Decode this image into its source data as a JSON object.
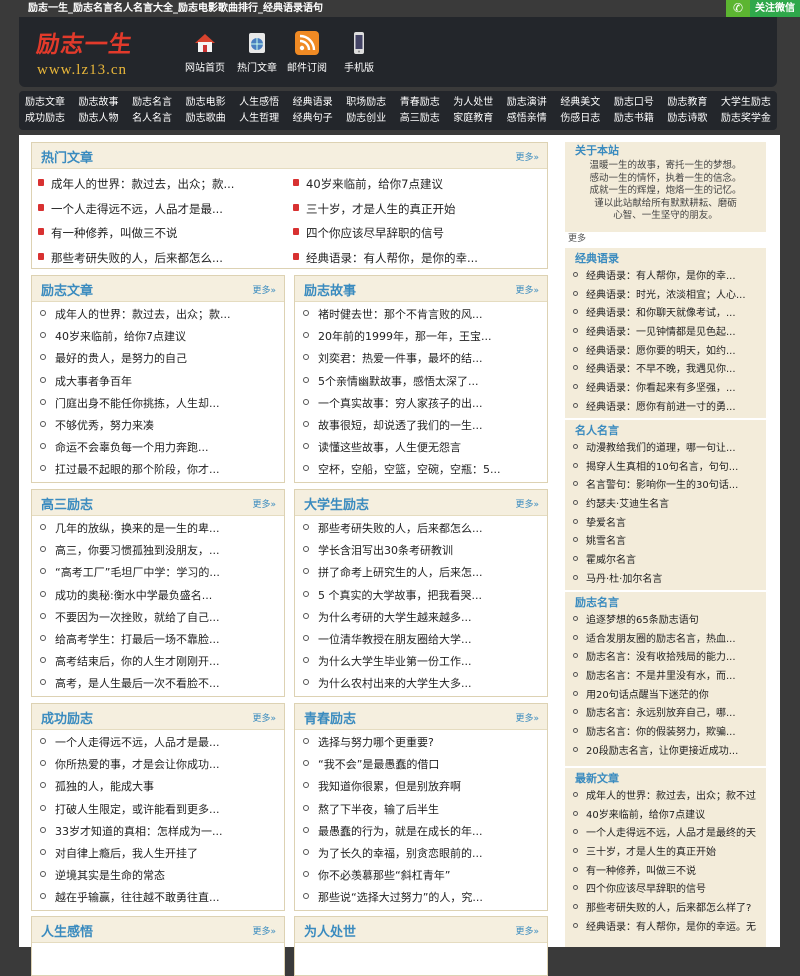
{
  "topbar": {
    "title": "励志一生_励志名言名人名言大全_励志电影歌曲排行_经典语录语句",
    "wechat": "关注微信"
  },
  "logo": {
    "cn": "励志一生",
    "url": "www.lz13.cn"
  },
  "header_nav": [
    "网站首页",
    "热门文章",
    "邮件订阅",
    "手机版"
  ],
  "nav_row1": [
    "励志文章",
    "励志故事",
    "励志名言",
    "励志电影",
    "人生感悟",
    "经典语录",
    "职场励志",
    "青春励志",
    "为人处世",
    "励志演讲",
    "经典美文",
    "励志口号",
    "励志教育",
    "大学生励志"
  ],
  "nav_row2": [
    "成功励志",
    "励志人物",
    "名人名言",
    "励志歌曲",
    "人生哲理",
    "经典句子",
    "励志创业",
    "高三励志",
    "家庭教育",
    "感悟亲情",
    "伤感日志",
    "励志书籍",
    "励志诗歌",
    "励志奖学金"
  ],
  "more": "更多»",
  "hot": {
    "title": "热门文章",
    "items": [
      "成年人的世界：款过去，出众；款...",
      "40岁来临前，给你7点建议",
      "一个人走得远不远，人品才是最...",
      "三十岁，才是人生的真正开始",
      "有一种修养，叫做三不说",
      "四个你应该尽早辞职的信号",
      "那些考研失败的人，后来都怎么...",
      "经典语录：有人帮你，是你的幸..."
    ]
  },
  "boxes": [
    {
      "title": "励志文章",
      "items": [
        "成年人的世界：款过去，出众；款...",
        "40岁来临前，给你7点建议",
        "最好的贵人，是努力的自己",
        "成大事者争百年",
        "门庭出身不能任你挑拣，人生却...",
        "不够优秀，努力来凑",
        "命运不会辜负每一个用力奔跑...",
        "扛过最不起眼的那个阶段，你才..."
      ]
    },
    {
      "title": "励志故事",
      "items": [
        "褚时健去世：那个不肯言败的风...",
        "20年前的1999年，那一年，王宝...",
        "刘奕君：热爱一件事，最坏的结...",
        "5个亲情幽默故事，感悟太深了...",
        "一个真实故事：穷人家孩子的出...",
        "故事很短，却说透了我们的一生...",
        "读懂这些故事，人生便无怨言",
        "空杯，空船，空篮，空碗，空瓶：5..."
      ]
    },
    {
      "title": "高三励志",
      "items": [
        "几年的放纵，换来的是一生的卑...",
        "高三，你要习惯孤独到没朋友，...",
        "“高考工厂”毛坦厂中学：学习的...",
        "成功的奥秘:衡水中学最负盛名...",
        "不要因为一次挫败，就给了自己...",
        "给高考学生：打最后一场不靠脸...",
        "高考结束后，你的人生才刚刚开...",
        "高考，是人生最后一次不看脸不..."
      ]
    },
    {
      "title": "大学生励志",
      "items": [
        "那些考研失败的人，后来都怎么...",
        "学长含泪写出30条考研教训",
        "拼了命考上研究生的人，后来怎...",
        "5 个真实的大学故事，把我看哭...",
        "为什么考研的大学生越来越多...",
        "一位清华教授在朋友圈给大学...",
        "为什么大学生毕业第一份工作...",
        "为什么农村出来的大学生大多..."
      ]
    },
    {
      "title": "成功励志",
      "items": [
        "一个人走得远不远，人品才是最...",
        "你所热爱的事，才是会让你成功...",
        "孤独的人，能成大事",
        "打破人生限定，或许能看到更多...",
        "33岁才知道的真相：怎样成为一...",
        "对自律上瘾后，我人生开挂了",
        "逆境其实是生命的常态",
        "越在乎输赢，往往越不敢勇往直..."
      ]
    },
    {
      "title": "青春励志",
      "items": [
        "选择与努力哪个更重要?",
        "“我不会”是最愚蠢的借口",
        "我知道你很累，但是别放弃啊",
        "熬了下半夜，输了后半生",
        "最愚蠢的行为，就是在成长的年...",
        "为了长久的幸福，别贪恋眼前的...",
        "你不必羡慕那些“斜杠青年”",
        "那些说“选择大过努力”的人，究..."
      ]
    },
    {
      "title": "人生感悟",
      "items": []
    },
    {
      "title": "为人处世",
      "items": []
    }
  ],
  "side": {
    "about": {
      "title": "关于本站",
      "text": [
        "温暖一生的故事，寄托一生的梦想。",
        "感动一生的情怀，执着一生的信念。",
        "成就一生的辉煌，炮烙一生的记忆。",
        "谨以此站献给所有默默耕耘、磨砺",
        "心智、一生坚守的朋友。"
      ],
      "more": "更多"
    },
    "lists": [
      {
        "title": "经典语录",
        "items": [
          "经典语录：有人帮你，是你的幸...",
          "经典语录：时光，浓淡相宜；人心...",
          "经典语录：和你聊天就像考试，...",
          "经典语录：一见钟情都是见色起...",
          "经典语录：愿你要的明天，如约...",
          "经典语录：不早不晚，我遇见你...",
          "经典语录：你看起来有多坚强，...",
          "经典语录：愿你有前进一寸的勇..."
        ]
      },
      {
        "title": "名人名言",
        "items": [
          "动漫教给我们的道理，哪一句让...",
          "揭穿人生真相的10句名言，句句...",
          "名言警句：影响你一生的30句话...",
          "约瑟夫·艾迪生名言",
          "挚爱名言",
          "姚雪名言",
          "霍威尔名言",
          "马丹·杜·加尔名言"
        ]
      },
      {
        "title": "励志名言",
        "items": [
          "追逐梦想的65条励志语句",
          "适合发朋友圈的励志名言，热血...",
          "励志名言：没有收拾残局的能力...",
          "励志名言：不是井里没有水，而...",
          "用20句话点醒当下迷茫的你",
          "励志名言：永远别放弃自己，哪...",
          "励志名言：你的假装努力，欺骗...",
          "20段励志名言，让你更接近成功..."
        ]
      },
      {
        "title": "最新文章",
        "items": [
          "成年人的世界：款过去，出众；款不过",
          "40岁来临前，给你7点建议",
          "一个人走得远不远，人品才是最终的天",
          "三十岁，才是人生的真正开始",
          "有一种修养，叫做三不说",
          "四个你应该尽早辞职的信号",
          "那些考研失败的人，后来都怎么样了?",
          "经典语录：有人帮你，是你的幸运。无"
        ]
      }
    ]
  },
  "colors": {
    "accent": "#3a8bbf",
    "header_bg": "#23262b",
    "box_head": "#f5efdf",
    "side_bg": "#f3ecda",
    "bullet_red": "#d83131"
  },
  "icons": [
    "home-icon",
    "globe-icon",
    "rss-icon",
    "phone-icon",
    "wechat-icon"
  ]
}
